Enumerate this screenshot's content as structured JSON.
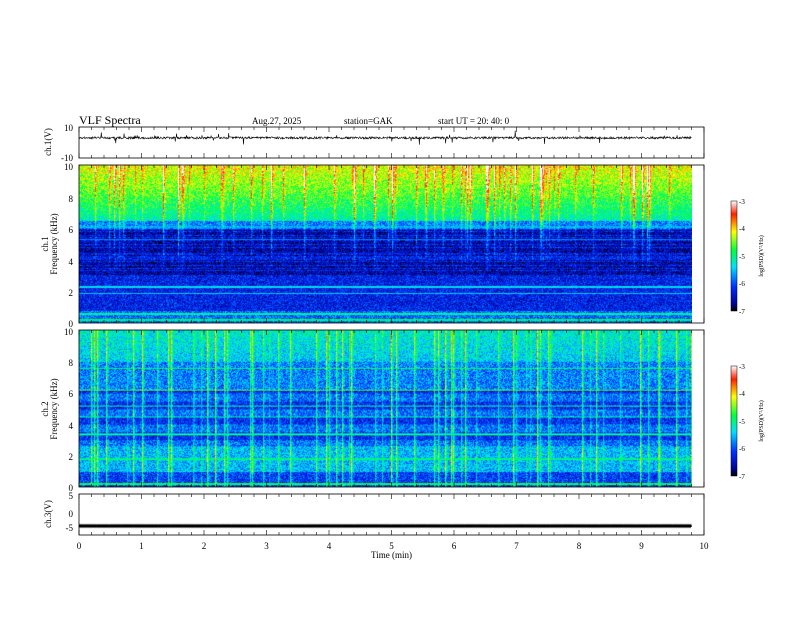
{
  "header": {
    "title": "VLF  Spectra",
    "date": "Aug.27, 2025",
    "station": "station=GAK",
    "start": "start  UT  =    20: 40: 0"
  },
  "chart_data": [
    {
      "type": "line",
      "panel": "ch1-waveform",
      "ylabel": "ch.1(V)",
      "ylim": [
        -10,
        10
      ],
      "yticks": [
        "10",
        "-10"
      ],
      "xlim": [
        0,
        10
      ],
      "baseline": 3,
      "color": "#000000"
    },
    {
      "type": "heatmap",
      "panel": "ch1-spectrogram",
      "ylabel": "ch.1",
      "ylabel2": "Frequency  (kHz)",
      "ylim": [
        0,
        10
      ],
      "yticks": [
        "0",
        "2",
        "4",
        "6",
        "8",
        "10"
      ],
      "xlim": [
        0,
        10
      ],
      "data_end_min": 9.8,
      "colorbar": {
        "label": "log(PSD)(V²/Hz)",
        "ticks": [
          "-3",
          "-4",
          "-5",
          "-6",
          "-7"
        ]
      }
    },
    {
      "type": "heatmap",
      "panel": "ch2-spectrogram",
      "ylabel": "ch.2",
      "ylabel2": "Frequency  (kHz)",
      "ylim": [
        0,
        10
      ],
      "yticks": [
        "0",
        "2",
        "4",
        "6",
        "8",
        "10"
      ],
      "xlim": [
        0,
        10
      ],
      "data_end_min": 9.8,
      "colorbar": {
        "label": "log(PSD)(V²/Hz)",
        "ticks": [
          "-3",
          "-4",
          "-5",
          "-6",
          "-7"
        ]
      }
    },
    {
      "type": "line",
      "panel": "ch3-waveform",
      "ylabel": "ch.3(V)",
      "ylim": [
        -5,
        5
      ],
      "yticks": [
        "5",
        "0",
        "-5"
      ],
      "xlim": [
        0,
        10
      ],
      "baseline": -2.8,
      "color": "#000000",
      "xlabel": "Time  (min)",
      "xticks": [
        "0",
        "1",
        "2",
        "3",
        "4",
        "5",
        "6",
        "7",
        "8",
        "9",
        "10"
      ]
    }
  ]
}
